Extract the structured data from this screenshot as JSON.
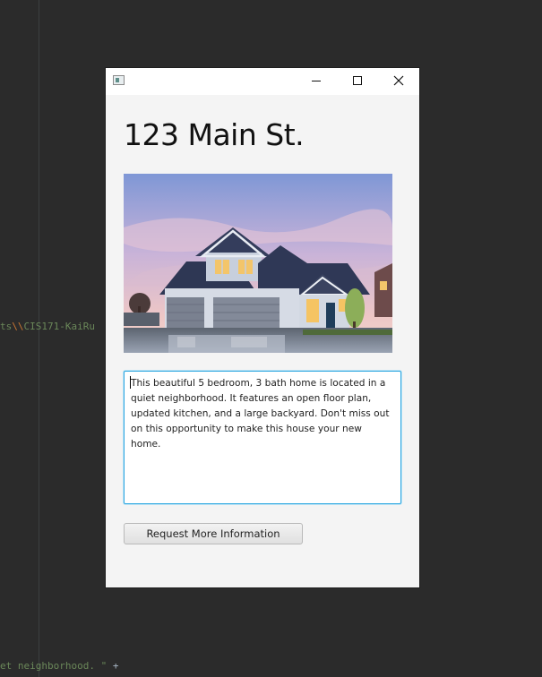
{
  "editor": {
    "code_path_prefix": "ts",
    "code_path_escape": "\\\\",
    "code_path_rest": "CIS171-KaiRu",
    "code_neighborhood": "et neighborhood. \"",
    "code_plus": "+"
  },
  "window": {
    "title_text": "",
    "icon": "java-app-icon"
  },
  "listing": {
    "address": "123 Main St.",
    "photo_subject": "two-story house with garage at dusk",
    "description": "This beautiful 5 bedroom, 3 bath home is located in a quiet neighborhood. It features an open floor plan, updated kitchen, and a large backyard. Don't miss out on this opportunity to make this house your new home.",
    "button_label": "Request More Information"
  }
}
